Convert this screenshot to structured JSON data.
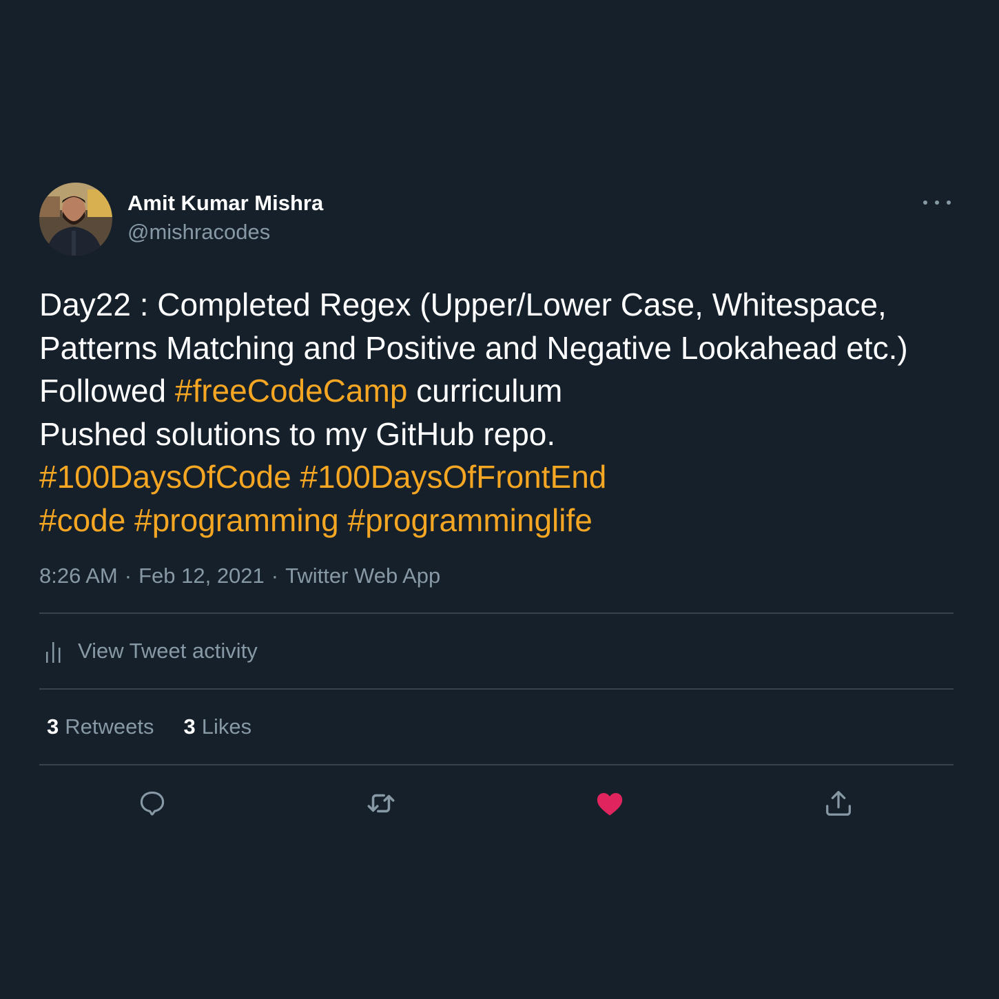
{
  "author": {
    "display_name": "Amit Kumar Mishra",
    "handle": "@mishracodes"
  },
  "tweet": {
    "lines": [
      [
        {
          "text": "Day22 : Completed Regex (Upper/Lower Case, Whitespace,"
        }
      ],
      [
        {
          "text": "Patterns Matching and Positive and Negative Lookahead etc.)"
        }
      ],
      [
        {
          "text": "Followed "
        },
        {
          "text": "#freeCodeCamp",
          "hashtag": true
        },
        {
          "text": " curriculum"
        }
      ],
      [
        {
          "text": "Pushed solutions to my GitHub repo."
        }
      ],
      [
        {
          "text": "#100DaysOfCode",
          "hashtag": true
        },
        {
          "text": " "
        },
        {
          "text": "#100DaysOfFrontEnd",
          "hashtag": true
        }
      ],
      [
        {
          "text": "#code",
          "hashtag": true
        },
        {
          "text": " "
        },
        {
          "text": "#programming",
          "hashtag": true
        },
        {
          "text": " "
        },
        {
          "text": "#programminglife",
          "hashtag": true
        }
      ]
    ],
    "time": "8:26 AM",
    "date": "Feb 12, 2021",
    "source": "Twitter Web App",
    "separator": "·"
  },
  "activity": {
    "label": "View Tweet activity",
    "icon": "bar-chart-icon"
  },
  "stats": {
    "retweets_count": "3",
    "retweets_label": "Retweets",
    "likes_count": "3",
    "likes_label": "Likes"
  },
  "actions": {
    "reply_icon": "reply-icon",
    "retweet_icon": "retweet-icon",
    "like_icon": "heart-icon",
    "share_icon": "share-icon",
    "liked": true
  },
  "colors": {
    "background": "#15202b",
    "hashtag": "#f5a623",
    "secondary_text": "#8899a6",
    "divider": "#38444d",
    "like": "#e0245e"
  }
}
